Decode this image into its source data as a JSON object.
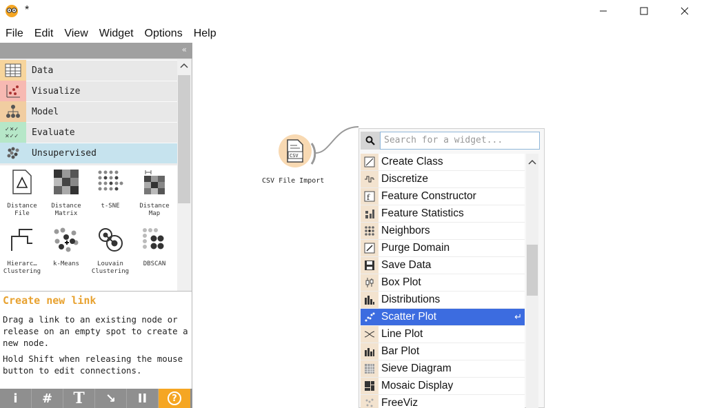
{
  "window": {
    "title": "*",
    "controls": {
      "minimize": "minimize-icon",
      "maximize": "maximize-icon",
      "close": "close-icon"
    }
  },
  "menu": [
    "File",
    "Edit",
    "View",
    "Widget",
    "Options",
    "Help"
  ],
  "dock": {
    "collapse_glyph": "«",
    "categories": [
      {
        "label": "Data",
        "icon": "table-icon",
        "color": "#f7d59c"
      },
      {
        "label": "Visualize",
        "icon": "scatter-icon",
        "color": "#f7b9b2"
      },
      {
        "label": "Model",
        "icon": "tree-icon",
        "color": "#f1cda1"
      },
      {
        "label": "Evaluate",
        "icon": "evaluate-icon",
        "color": "#b6e7c8"
      },
      {
        "label": "Unsupervised",
        "icon": "clusters-icon",
        "color": "#c6e3ee"
      }
    ],
    "widgets": [
      {
        "label": "Distance\nFile",
        "icon": "distance-file-icon"
      },
      {
        "label": "Distance\nMatrix",
        "icon": "distance-matrix-icon"
      },
      {
        "label": "t-SNE",
        "icon": "tsne-icon"
      },
      {
        "label": "Distance\nMap",
        "icon": "distance-map-icon"
      },
      {
        "label": "Hierarc…\nClustering",
        "icon": "hierarchical-clustering-icon"
      },
      {
        "label": "k-Means",
        "icon": "kmeans-icon"
      },
      {
        "label": "Louvain\nClustering",
        "icon": "louvain-icon"
      },
      {
        "label": "DBSCAN",
        "icon": "dbscan-icon"
      }
    ]
  },
  "help_panel": {
    "title": "Create new link",
    "text1": "Drag a link to an existing node or release on an empty spot to create a new node.",
    "text2": "Hold Shift when releasing the mouse button to edit connections."
  },
  "toolbar": {
    "buttons": [
      {
        "glyph": "i",
        "icon": "info-icon"
      },
      {
        "glyph": "#",
        "icon": "grid-icon"
      },
      {
        "glyph": "T",
        "icon": "text-annotation-icon"
      },
      {
        "glyph": "↘",
        "icon": "arrow-annotation-icon"
      },
      {
        "glyph": "II",
        "icon": "pause-icon"
      },
      {
        "glyph": "?",
        "icon": "help-icon"
      }
    ]
  },
  "canvas": {
    "node": {
      "label": "CSV File Import",
      "icon": "csv-file-icon",
      "icon_text": "CSV"
    }
  },
  "popup": {
    "search_placeholder": "Search for a widget...",
    "items": [
      {
        "label": "Create Class",
        "icon": "create-class-icon",
        "selected": false
      },
      {
        "label": "Discretize",
        "icon": "discretize-icon",
        "selected": false
      },
      {
        "label": "Feature Constructor",
        "icon": "feature-constructor-icon",
        "selected": false
      },
      {
        "label": "Feature Statistics",
        "icon": "feature-statistics-icon",
        "selected": false
      },
      {
        "label": "Neighbors",
        "icon": "neighbors-icon",
        "selected": false
      },
      {
        "label": "Purge Domain",
        "icon": "purge-domain-icon",
        "selected": false
      },
      {
        "label": "Save Data",
        "icon": "save-data-icon",
        "selected": false
      },
      {
        "label": "Box Plot",
        "icon": "box-plot-icon",
        "selected": false
      },
      {
        "label": "Distributions",
        "icon": "distributions-icon",
        "selected": false
      },
      {
        "label": "Scatter Plot",
        "icon": "scatter-plot-icon",
        "selected": true,
        "enter_glyph": "↵"
      },
      {
        "label": "Line Plot",
        "icon": "line-plot-icon",
        "selected": false
      },
      {
        "label": "Bar Plot",
        "icon": "bar-plot-icon",
        "selected": false
      },
      {
        "label": "Sieve Diagram",
        "icon": "sieve-diagram-icon",
        "selected": false
      },
      {
        "label": "Mosaic Display",
        "icon": "mosaic-display-icon",
        "selected": false
      },
      {
        "label": "FreeViz",
        "icon": "freeviz-icon",
        "selected": false
      }
    ]
  },
  "colors": {
    "selection": "#3c6ce0",
    "help_title": "#e8a230",
    "toolbar_help": "#f5a623",
    "node_fill": "#f8d9b2"
  }
}
